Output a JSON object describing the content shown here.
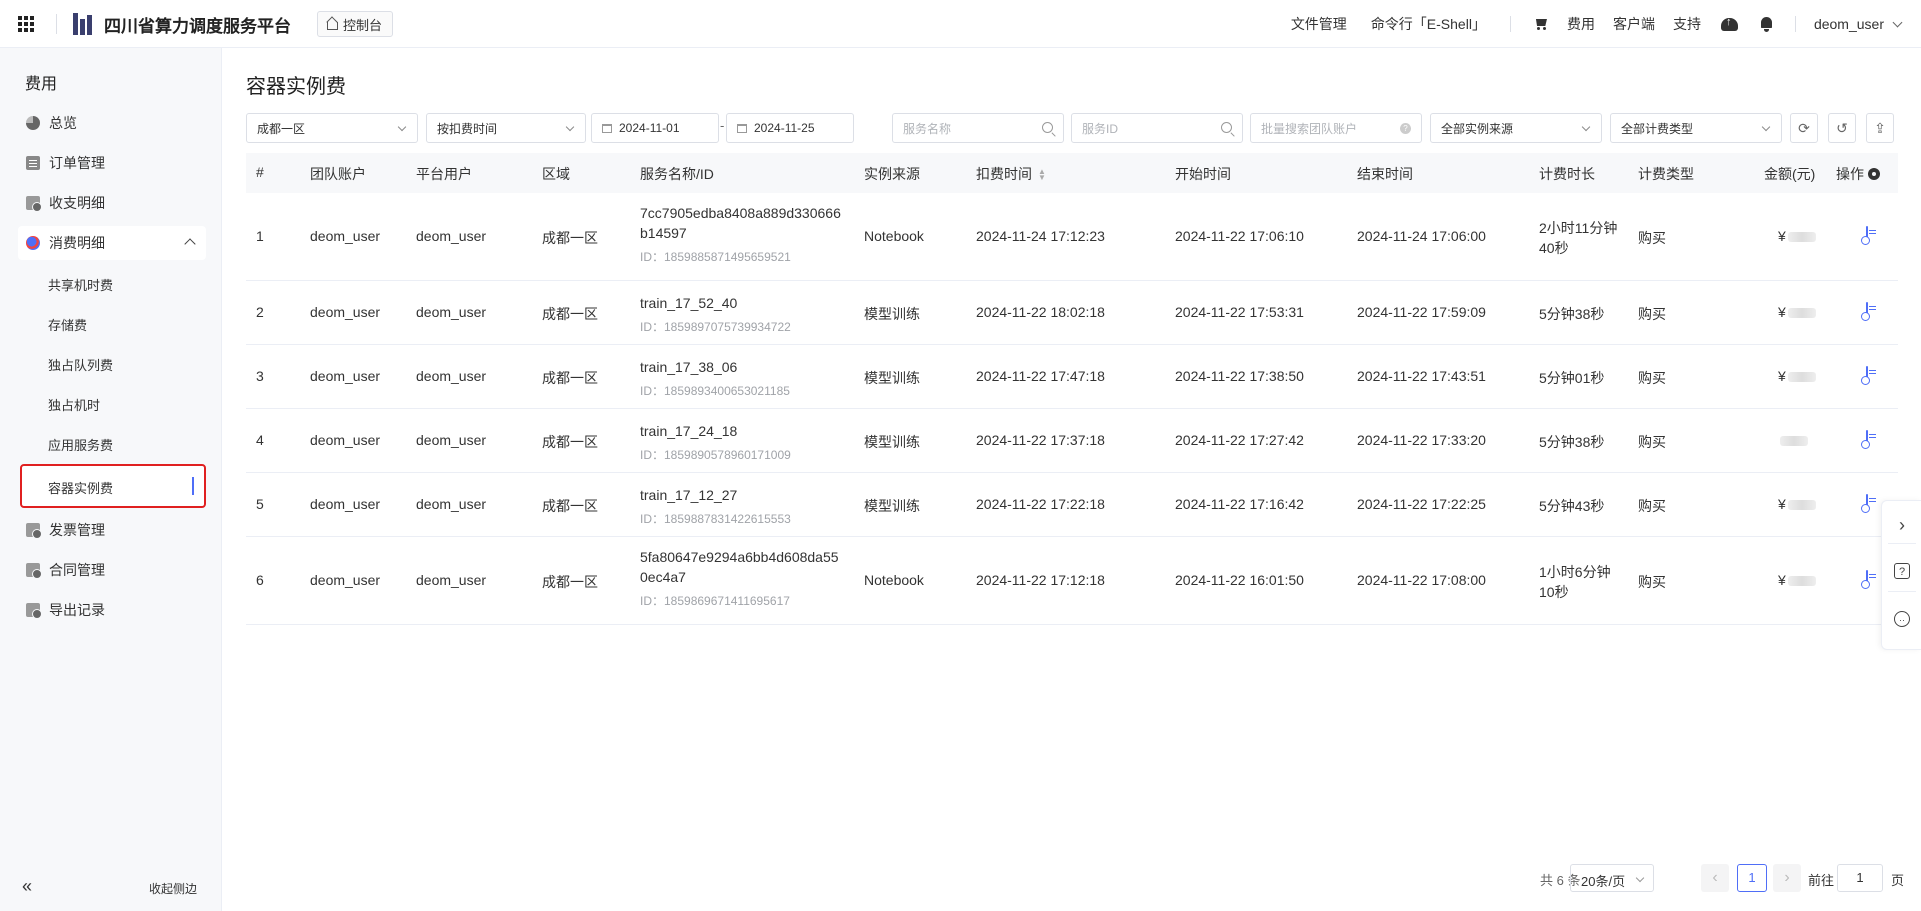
{
  "topbar": {
    "brand": "四川省算力调度服务平台",
    "console": "控制台",
    "links": [
      "文件管理",
      "命令行「E-Shell」"
    ],
    "cost": "费用",
    "client": "客户端",
    "support": "支持",
    "user": "deom_user"
  },
  "sidebar": {
    "title": "费用",
    "items": {
      "overview": "总览",
      "orders": "订单管理",
      "income": "收支明细",
      "spend": "消费明细",
      "invoice": "发票管理",
      "contract": "合同管理",
      "export": "导出记录"
    },
    "sub": {
      "shared": "共享机时费",
      "storage": "存储费",
      "queue": "独占队列费",
      "exclusive": "独占机时",
      "app": "应用服务费",
      "container": "容器实例费"
    },
    "collapse": "收起侧边"
  },
  "main": {
    "title": "容器实例费",
    "filters": {
      "region": "成都一区",
      "time_type": "按扣费时间",
      "date_start": "2024-11-01",
      "date_sep": "-",
      "date_end": "2024-11-25",
      "service_name_ph": "服务名称",
      "service_id_ph": "服务ID",
      "team_ph": "批量搜索团队账户",
      "source": "全部实例来源",
      "billing_type": "全部计费类型"
    },
    "columns": [
      "#",
      "团队账户",
      "平台用户",
      "区域",
      "服务名称/ID",
      "实例来源",
      "扣费时间",
      "开始时间",
      "结束时间",
      "计费时长",
      "计费类型",
      "金额(元)",
      "操作"
    ],
    "rows": [
      {
        "idx": "1",
        "team": "deom_user",
        "user": "deom_user",
        "region": "成都一区",
        "name": "7cc7905edba8408a889d330666b14597",
        "id": "ID：1859885871495659521",
        "source": "Notebook",
        "charge": "2024-11-24 17:12:23",
        "start": "2024-11-22 17:06:10",
        "end": "2024-11-24 17:06:00",
        "duration": "2小时11分钟40秒",
        "type": "购买",
        "amount": "¥"
      },
      {
        "idx": "2",
        "team": "deom_user",
        "user": "deom_user",
        "region": "成都一区",
        "name": "train_17_52_40",
        "id": "ID：1859897075739934722",
        "source": "模型训练",
        "charge": "2024-11-22 18:02:18",
        "start": "2024-11-22 17:53:31",
        "end": "2024-11-22 17:59:09",
        "duration": "5分钟38秒",
        "type": "购买",
        "amount": "¥"
      },
      {
        "idx": "3",
        "team": "deom_user",
        "user": "deom_user",
        "region": "成都一区",
        "name": "train_17_38_06",
        "id": "ID：1859893400653021185",
        "source": "模型训练",
        "charge": "2024-11-22 17:47:18",
        "start": "2024-11-22 17:38:50",
        "end": "2024-11-22 17:43:51",
        "duration": "5分钟01秒",
        "type": "购买",
        "amount": "¥"
      },
      {
        "idx": "4",
        "team": "deom_user",
        "user": "deom_user",
        "region": "成都一区",
        "name": "train_17_24_18",
        "id": "ID：1859890578960171009",
        "source": "模型训练",
        "charge": "2024-11-22 17:37:18",
        "start": "2024-11-22 17:27:42",
        "end": "2024-11-22 17:33:20",
        "duration": "5分钟38秒",
        "type": "购买",
        "amount": ""
      },
      {
        "idx": "5",
        "team": "deom_user",
        "user": "deom_user",
        "region": "成都一区",
        "name": "train_17_12_27",
        "id": "ID：1859887831422615553",
        "source": "模型训练",
        "charge": "2024-11-22 17:22:18",
        "start": "2024-11-22 17:16:42",
        "end": "2024-11-22 17:22:25",
        "duration": "5分钟43秒",
        "type": "购买",
        "amount": "¥"
      },
      {
        "idx": "6",
        "team": "deom_user",
        "user": "deom_user",
        "region": "成都一区",
        "name": "5fa80647e9294a6bb4d608da550ec4a7",
        "id": "ID：1859869671411695617",
        "source": "Notebook",
        "charge": "2024-11-22 17:12:18",
        "start": "2024-11-22 16:01:50",
        "end": "2024-11-22 17:08:00",
        "duration": "1小时6分钟10秒",
        "type": "购买",
        "amount": "¥"
      }
    ],
    "pagination": {
      "total": "共 6 条",
      "page_size": "20条/页",
      "current": "1",
      "goto_label": "前往",
      "goto_value": "1",
      "page_suffix": "页"
    }
  },
  "colors": {
    "accent": "#4f6ef7",
    "highlight": "#e02020"
  }
}
